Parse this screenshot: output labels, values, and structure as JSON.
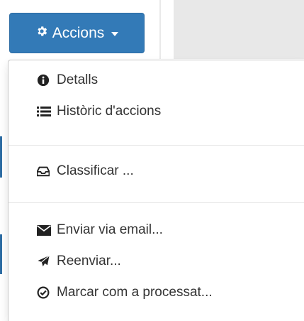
{
  "button": {
    "label": "Accions"
  },
  "menu": {
    "items": [
      {
        "label": "Detalls",
        "icon": "info-circle-icon"
      },
      {
        "label": "Històric d'accions",
        "icon": "list-icon"
      },
      {
        "label": "Classificar ...",
        "icon": "inbox-icon"
      },
      {
        "label": "Enviar via email...",
        "icon": "envelope-icon"
      },
      {
        "label": "Reenviar...",
        "icon": "send-icon"
      },
      {
        "label": "Marcar com a processat...",
        "icon": "check-circle-icon"
      }
    ]
  },
  "colors": {
    "primary": "#337ab7",
    "text": "#333333",
    "divider": "#e5e5e5"
  }
}
